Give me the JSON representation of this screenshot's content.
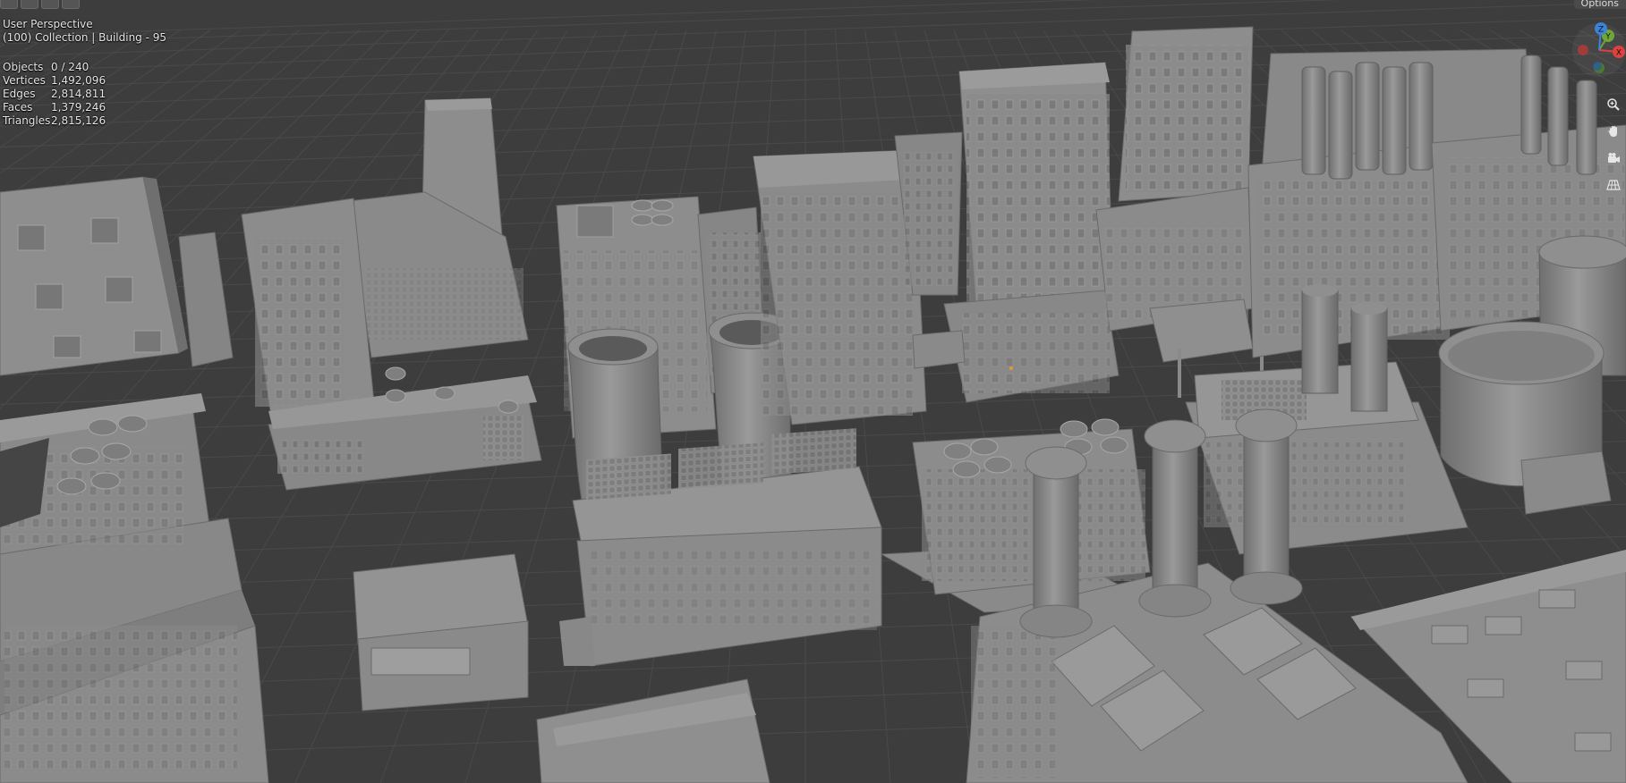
{
  "viewport": {
    "view_name": "User Perspective",
    "context": "(100) Collection | Building - 95",
    "options_label": "Options",
    "stats": [
      {
        "label": "Objects",
        "value": "0 / 240"
      },
      {
        "label": "Vertices",
        "value": "1,492,096"
      },
      {
        "label": "Edges",
        "value": "2,814,811"
      },
      {
        "label": "Faces",
        "value": "1,379,246"
      },
      {
        "label": "Triangles",
        "value": "2,815,126"
      }
    ]
  },
  "gizmo": {
    "axes": [
      {
        "label": "X",
        "color": "#e0413f"
      },
      {
        "label": "Y",
        "color": "#6ea63a"
      },
      {
        "label": "Z",
        "color": "#3c82d6"
      }
    ]
  },
  "nav_icons": [
    "zoom-icon",
    "pan-hand-icon",
    "camera-view-icon",
    "grid-ortho-icon"
  ],
  "colors": {
    "background": "#3d3d3d",
    "grid": "#4a4a4a",
    "model": "#8c8c8c"
  }
}
